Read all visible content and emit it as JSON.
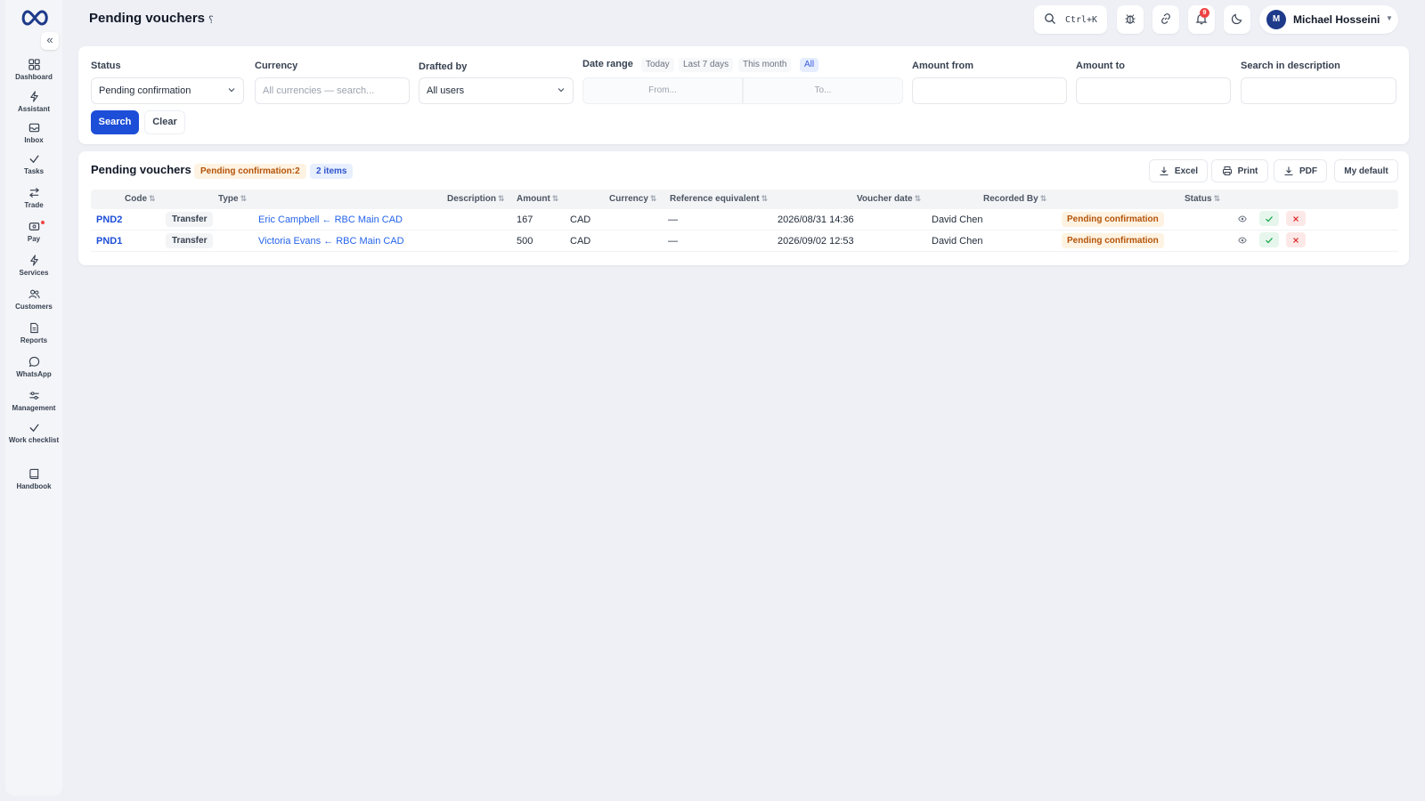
{
  "header": {
    "title": "Pending vouchers",
    "title_glyph": "؟",
    "search_shortcut": "Ctrl+K",
    "notification_count": "9",
    "user": {
      "initial": "M",
      "name": "Michael Hosseini"
    }
  },
  "sidebar": {
    "collapse_label": "«",
    "items": [
      {
        "label": "Dashboard",
        "icon": "dashboard-icon"
      },
      {
        "label": "Assistant",
        "icon": "bolt-icon"
      },
      {
        "label": "Inbox",
        "icon": "inbox-icon"
      },
      {
        "label": "Tasks",
        "icon": "check-icon"
      },
      {
        "label": "Trade",
        "icon": "swap-icon"
      },
      {
        "label": "Pay",
        "icon": "wallet-icon"
      },
      {
        "label": "Services",
        "icon": "bolt-icon"
      },
      {
        "label": "Customers",
        "icon": "users-icon"
      },
      {
        "label": "Reports",
        "icon": "document-icon"
      },
      {
        "label": "WhatsApp",
        "icon": "chat-icon"
      },
      {
        "label": "Management",
        "icon": "sliders-icon"
      },
      {
        "label": "Work checklist",
        "icon": "check-icon"
      },
      {
        "label": "Handbook",
        "icon": "book-icon"
      }
    ]
  },
  "filters": {
    "status": {
      "label": "Status",
      "value": "Pending confirmation"
    },
    "currency": {
      "label": "Currency",
      "placeholder": "All currencies — search..."
    },
    "drafted_by": {
      "label": "Drafted by",
      "value": "All users"
    },
    "date_range": {
      "label": "Date range",
      "chips": [
        "Today",
        "Last 7 days",
        "This month",
        "All"
      ],
      "active": "All",
      "from_placeholder": "From...",
      "to_placeholder": "To..."
    },
    "amount_from": {
      "label": "Amount from",
      "value": ""
    },
    "amount_to": {
      "label": "Amount to",
      "value": ""
    },
    "description": {
      "label": "Search in description",
      "value": ""
    },
    "search_button": "Search",
    "clear_button": "Clear"
  },
  "results": {
    "title": "Pending vouchers",
    "status_badge": "Pending confirmation:2",
    "count_badge": "2 items",
    "toolbar": {
      "excel": "Excel",
      "print": "Print",
      "pdf": "PDF",
      "my_default": "My default"
    },
    "columns": [
      "Code",
      "Type",
      "Description",
      "Amount",
      "Currency",
      "Reference equivalent",
      "Voucher date",
      "Recorded By",
      "Status"
    ],
    "sort_glyph": "⇅",
    "rows": [
      {
        "code": "PND2",
        "type": "Transfer",
        "description": "Eric Campbell ← RBC Main CAD",
        "amount": "167",
        "currency": "CAD",
        "reference": "—",
        "date": "2026/08/31 14:36",
        "recorded_by": "David Chen",
        "status": "Pending confirmation"
      },
      {
        "code": "PND1",
        "type": "Transfer",
        "description": "Victoria Evans ← RBC Main CAD",
        "amount": "500",
        "currency": "CAD",
        "reference": "—",
        "date": "2026/09/02 12:53",
        "recorded_by": "David Chen",
        "status": "Pending confirmation"
      }
    ]
  },
  "colors": {
    "primary": "#1d4ed8",
    "warning_bg": "#fef3e2",
    "warning_text": "#b45309",
    "success_bg": "#e6f6ec",
    "danger_bg": "#fde8e8",
    "page_bg": "#eef0f6"
  }
}
